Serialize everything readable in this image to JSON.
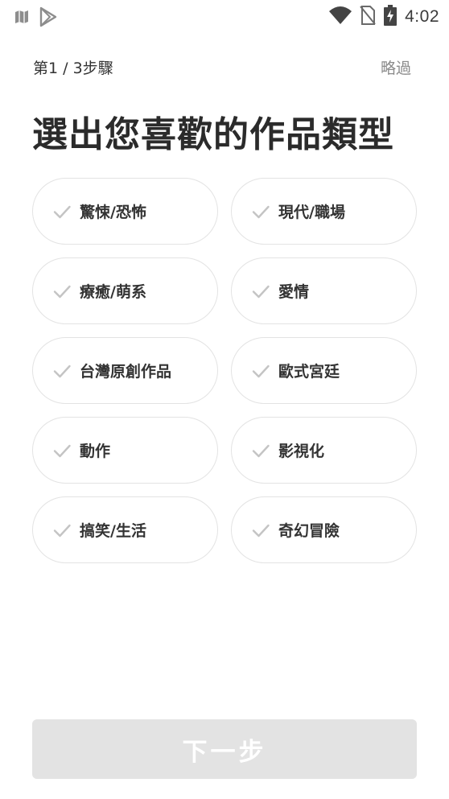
{
  "status_bar": {
    "time": "4:02",
    "icons": [
      "map-icon",
      "play-store-icon",
      "wifi-icon",
      "no-sim-icon",
      "battery-charging-icon"
    ]
  },
  "header": {
    "step": "第1 / 3步驟",
    "skip": "略過"
  },
  "title": "選出您喜歡的作品類型",
  "genres": [
    {
      "label": "驚悚/恐怖",
      "selected": false
    },
    {
      "label": "現代/職場",
      "selected": false
    },
    {
      "label": "療癒/萌系",
      "selected": false
    },
    {
      "label": "愛情",
      "selected": false
    },
    {
      "label": "台灣原創作品",
      "selected": false
    },
    {
      "label": "歐式宮廷",
      "selected": false
    },
    {
      "label": "動作",
      "selected": false
    },
    {
      "label": "影視化",
      "selected": false
    },
    {
      "label": "搞笑/生活",
      "selected": false
    },
    {
      "label": "奇幻冒險",
      "selected": false
    }
  ],
  "next_button": {
    "label": "下一步",
    "enabled": false
  },
  "colors": {
    "chip_border": "#e3e3e3",
    "check_icon": "#c4c4c4",
    "button_disabled": "#e3e3e3",
    "skip_text": "#8a8a8a"
  }
}
